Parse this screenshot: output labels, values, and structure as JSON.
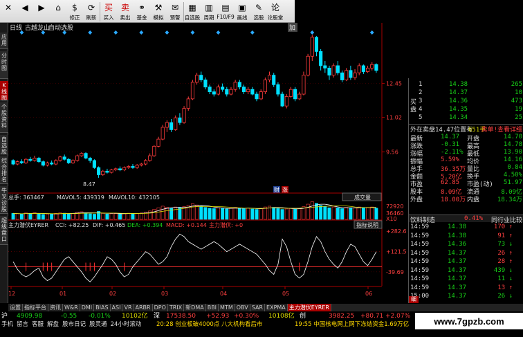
{
  "toolbar": [
    {
      "icon": "✕",
      "label": "",
      "name": "close"
    },
    {
      "icon": "◀",
      "label": "",
      "name": "back"
    },
    {
      "icon": "▶",
      "label": "",
      "name": "forward"
    },
    {
      "icon": "⌂",
      "label": "",
      "name": "home"
    },
    {
      "icon": "$",
      "label": "修正",
      "name": "correct"
    },
    {
      "icon": "⟳",
      "label": "刷新",
      "name": "refresh"
    },
    {
      "icon": "买",
      "label": "买入",
      "name": "buy"
    },
    {
      "icon": "卖",
      "label": "卖出",
      "name": "sell"
    },
    {
      "icon": "⚭",
      "label": "基金",
      "name": "fund"
    },
    {
      "icon": "⚒",
      "label": "模拟",
      "name": "simulate"
    },
    {
      "icon": "✉",
      "label": "预警",
      "name": "alert"
    },
    {
      "icon": "▦",
      "label": "自选股",
      "name": "watchlist"
    },
    {
      "icon": "▥",
      "label": "周期",
      "name": "period"
    },
    {
      "icon": "▤",
      "label": "F10/F9",
      "name": "f10"
    },
    {
      "icon": "▣",
      "label": "画线",
      "name": "draw"
    },
    {
      "icon": "✎",
      "label": "选股",
      "name": "select-stock"
    },
    {
      "icon": "论",
      "label": "论股堂",
      "name": "forum"
    }
  ],
  "left_tabs": [
    {
      "label": "应用",
      "active": false
    },
    {
      "label": "分时图",
      "active": false
    },
    {
      "label": "K线图",
      "active": true
    },
    {
      "label": "个股资料",
      "active": false
    },
    {
      "label": "自选股",
      "active": false
    },
    {
      "label": "综合排名",
      "active": false
    },
    {
      "label": "牛叉诊股",
      "active": false
    },
    {
      "label": "超级盘口",
      "active": false
    }
  ],
  "chart_header": {
    "period": "日线",
    "stock": "古越龙山",
    "mode": "自动选股",
    "add": "加"
  },
  "price_axis": [
    "12.45",
    "11.02",
    "9.56"
  ],
  "price_low_label": "8.47",
  "chart_badges": {
    "cai": "财",
    "zhang": "涨"
  },
  "volume": {
    "label": "总手: 363467",
    "ma5": "MAVOL5: 439319",
    "ma10": "MAVOL10: 432105",
    "button": "成交量",
    "axis": [
      "72920",
      "36460",
      "X10"
    ]
  },
  "indicator": {
    "title": "主力潜伏EYRER",
    "cci": "CCI: +82.25",
    "dif": "DIF: +0.465",
    "dea": "DEA: +0.394",
    "macd": "MACD: +0.144",
    "zl": "主力潜伏: +0",
    "button": "指标说明",
    "axis": [
      "+282.6",
      "+121.5",
      "-39.69"
    ]
  },
  "x_axis": [
    "12",
    "01",
    "02",
    "03",
    "04",
    "05",
    "06"
  ],
  "chart_data": {
    "type": "candlestick",
    "title": "",
    "ylim": [
      8.0,
      14.6
    ],
    "ticks": [
      12.45,
      11.02,
      9.56
    ],
    "candles": [
      [
        9.2,
        9.05,
        9.25,
        9.0
      ],
      [
        9.05,
        9.15,
        9.2,
        9.0
      ],
      [
        9.15,
        9.1,
        9.25,
        9.05
      ],
      [
        9.1,
        9.25,
        9.3,
        9.05
      ],
      [
        9.25,
        9.2,
        9.35,
        9.15
      ],
      [
        9.2,
        9.3,
        9.4,
        9.15
      ],
      [
        9.3,
        9.15,
        9.35,
        9.1
      ],
      [
        9.15,
        9.0,
        9.2,
        8.95
      ],
      [
        9.0,
        9.1,
        9.15,
        8.95
      ],
      [
        9.1,
        9.05,
        9.2,
        9.0
      ],
      [
        9.05,
        9.2,
        9.25,
        9.0
      ],
      [
        9.2,
        9.35,
        9.4,
        9.15
      ],
      [
        9.35,
        9.25,
        9.45,
        9.2
      ],
      [
        9.25,
        9.1,
        9.3,
        9.05
      ],
      [
        9.1,
        9.2,
        9.25,
        9.05
      ],
      [
        9.2,
        9.4,
        9.45,
        9.15
      ],
      [
        9.4,
        9.5,
        9.55,
        9.35
      ],
      [
        9.5,
        9.3,
        9.55,
        9.25
      ],
      [
        9.3,
        9.2,
        9.35,
        9.1
      ],
      [
        9.2,
        8.9,
        9.25,
        8.85
      ],
      [
        8.9,
        8.6,
        8.95,
        8.47
      ],
      [
        8.6,
        8.75,
        8.8,
        8.55
      ],
      [
        8.75,
        8.7,
        8.85,
        8.65
      ],
      [
        8.7,
        8.8,
        8.85,
        8.65
      ],
      [
        8.8,
        8.85,
        8.9,
        8.75
      ],
      [
        8.85,
        8.8,
        8.95,
        8.75
      ],
      [
        8.8,
        8.9,
        8.95,
        8.75
      ],
      [
        8.9,
        8.95,
        9.0,
        8.85
      ],
      [
        8.95,
        8.9,
        9.05,
        8.85
      ],
      [
        8.9,
        9.0,
        9.05,
        8.85
      ],
      [
        9.0,
        9.05,
        9.1,
        8.95
      ],
      [
        9.05,
        9.2,
        9.25,
        9.0
      ],
      [
        9.2,
        9.4,
        9.5,
        9.15
      ],
      [
        9.4,
        9.8,
        9.85,
        9.35
      ],
      [
        9.8,
        10.1,
        10.2,
        9.75
      ],
      [
        10.1,
        10.6,
        10.7,
        10.05
      ],
      [
        10.6,
        10.8,
        10.9,
        10.4
      ],
      [
        10.8,
        10.5,
        10.95,
        10.4
      ],
      [
        10.5,
        11.0,
        11.1,
        10.45
      ],
      [
        11.0,
        10.8,
        11.2,
        10.7
      ],
      [
        10.8,
        11.4,
        11.5,
        10.75
      ],
      [
        11.4,
        11.8,
        11.9,
        11.3
      ],
      [
        11.8,
        12.5,
        12.6,
        11.75
      ],
      [
        12.5,
        12.8,
        12.9,
        12.4
      ],
      [
        12.8,
        12.6,
        12.95,
        12.5
      ],
      [
        12.6,
        12.3,
        12.7,
        12.2
      ],
      [
        12.3,
        12.1,
        12.4,
        12.0
      ],
      [
        12.1,
        12.0,
        12.2,
        11.9
      ],
      [
        12.0,
        12.3,
        12.4,
        11.95
      ],
      [
        12.3,
        12.2,
        12.45,
        12.1
      ],
      [
        12.2,
        12.0,
        12.3,
        11.9
      ],
      [
        12.0,
        12.2,
        12.3,
        11.95
      ],
      [
        12.2,
        12.5,
        12.6,
        12.1
      ],
      [
        12.5,
        12.3,
        12.6,
        12.2
      ],
      [
        12.3,
        12.1,
        12.4,
        12.0
      ],
      [
        12.1,
        12.2,
        12.3,
        12.0
      ],
      [
        12.2,
        12.0,
        12.3,
        11.95
      ],
      [
        12.0,
        11.8,
        12.1,
        11.7
      ],
      [
        11.8,
        12.1,
        12.2,
        11.75
      ],
      [
        12.1,
        12.6,
        12.7,
        12.0
      ],
      [
        12.6,
        12.8,
        12.95,
        12.5
      ],
      [
        12.8,
        12.4,
        12.9,
        12.3
      ],
      [
        12.4,
        12.0,
        12.5,
        11.9
      ],
      [
        12.0,
        11.5,
        12.1,
        11.45
      ],
      [
        11.5,
        11.9,
        12.0,
        11.4
      ],
      [
        11.9,
        12.2,
        12.3,
        11.85
      ],
      [
        12.2,
        11.8,
        12.3,
        11.7
      ],
      [
        11.8,
        12.0,
        12.1,
        11.75
      ],
      [
        12.0,
        12.8,
        12.95,
        11.95
      ],
      [
        12.8,
        13.6,
        13.7,
        12.75
      ],
      [
        13.6,
        14.4,
        14.5,
        13.4
      ],
      [
        14.4,
        13.8,
        14.45,
        13.6
      ],
      [
        13.8,
        13.2,
        13.9,
        13.0
      ],
      [
        13.2,
        13.1,
        13.4,
        12.9
      ],
      [
        13.1,
        12.8,
        13.2,
        12.6
      ],
      [
        12.8,
        13.2,
        13.3,
        12.7
      ],
      [
        13.2,
        12.9,
        13.4,
        12.8
      ],
      [
        12.9,
        12.6,
        13.0,
        12.5
      ],
      [
        12.6,
        13.0,
        13.1,
        12.55
      ],
      [
        13.0,
        12.7,
        13.2,
        12.6
      ],
      [
        12.7,
        12.9,
        13.05,
        12.6
      ],
      [
        12.9,
        13.2,
        13.3,
        12.8
      ],
      [
        13.2,
        12.95,
        13.25,
        12.85
      ],
      [
        12.95,
        13.1,
        13.2,
        12.9
      ],
      [
        13.1,
        13.25,
        13.35,
        13.0
      ],
      [
        13.25,
        13.0,
        13.3,
        12.9
      ]
    ],
    "volume": [
      30,
      28,
      26,
      32,
      30,
      34,
      28,
      25,
      27,
      26,
      30,
      33,
      31,
      27,
      29,
      36,
      38,
      33,
      28,
      26,
      40,
      30,
      27,
      28,
      29,
      27,
      30,
      31,
      29,
      30,
      32,
      36,
      42,
      50,
      58,
      66,
      60,
      55,
      62,
      58,
      64,
      70,
      78,
      72,
      65,
      60,
      56,
      54,
      58,
      55,
      52,
      56,
      60,
      57,
      54,
      56,
      52,
      50,
      55,
      62,
      66,
      60,
      54,
      50,
      52,
      56,
      52,
      54,
      64,
      76,
      88,
      80,
      70,
      64,
      58,
      62,
      58,
      54,
      60,
      56,
      58,
      62,
      58,
      60,
      62,
      56
    ],
    "indicator": [
      40,
      -20,
      -60,
      -80,
      -60,
      -30,
      -10,
      -80,
      -110,
      -90,
      -40,
      10,
      60,
      80,
      40,
      0,
      -40,
      -90,
      -120,
      -80,
      -30,
      20,
      80,
      60,
      20,
      -40,
      -80,
      -60,
      0,
      40,
      80,
      120,
      100,
      60,
      20,
      40,
      80,
      160,
      220,
      260,
      240,
      200,
      180,
      160,
      140,
      160,
      180,
      200,
      180,
      150,
      120,
      140,
      160,
      180,
      160,
      140,
      120,
      100,
      60,
      20,
      -30,
      -60,
      20,
      220,
      160,
      40,
      -60,
      -90,
      -60,
      40,
      160,
      240,
      200,
      120,
      60,
      20,
      -10,
      40,
      120,
      180,
      160,
      100,
      40,
      10,
      60,
      120
    ]
  },
  "right_panel": {
    "sell": [
      {
        "lvl": "1",
        "price": "14.38",
        "vol": "265"
      },
      {
        "lvl": "2",
        "price": "14.37",
        "vol": "10"
      },
      {
        "lvl": "3",
        "price": "14.36",
        "vol": "473"
      },
      {
        "lvl": "4",
        "price": "14.35",
        "vol": "19"
      },
      {
        "lvl": "5",
        "price": "14.34",
        "vol": "25"
      }
    ],
    "buy_label": "买盘",
    "summary_line": "外在卖盘14.47位置有",
    "summary_vol": "651手",
    "summary_link": "卖单!查看详细",
    "stats": [
      {
        "l1": "最新",
        "v1": "14.37",
        "l2": "开盘",
        "v2": "14.70"
      },
      {
        "l1": "涨跌",
        "v1": "-0.31",
        "l2": "最高",
        "v2": "14.78"
      },
      {
        "l1": "涨幅",
        "v1": "-2.11%",
        "l2": "最低",
        "v2": "13.90"
      },
      {
        "l1": "振幅",
        "v1": "5.59%",
        "l2": "均价",
        "v2": "14.16"
      },
      {
        "l1": "总手",
        "v1": "36.35万",
        "l2": "量比",
        "v2": "0.84"
      },
      {
        "l1": "金额",
        "v1": "5.20亿",
        "l2": "换手",
        "v2": "4.50%"
      },
      {
        "l1": "市盈",
        "v1": "62.85",
        "l2": "市盈(动)",
        "v2": "51.97"
      },
      {
        "l1": "股本",
        "v1": "8.09亿",
        "l2": "流通",
        "v2": "8.09亿"
      },
      {
        "l1": "外盘",
        "v1": "18.00万",
        "l2": "内盘",
        "v2": "18.34万"
      }
    ],
    "industry": {
      "name": "饮料制造",
      "pct": "0.41%",
      "link": "同行业比较"
    },
    "ticks": [
      {
        "t": "14:59",
        "p": "14.38",
        "v": "170",
        "d": "up"
      },
      {
        "t": "14:59",
        "p": "14.38",
        "v": "91",
        "d": "up"
      },
      {
        "t": "14:59",
        "p": "14.36",
        "v": "73",
        "d": "down"
      },
      {
        "t": "14:59",
        "p": "14.37",
        "v": "26",
        "d": "up"
      },
      {
        "t": "14:59",
        "p": "14.37",
        "v": "28",
        "d": "up"
      },
      {
        "t": "14:59",
        "p": "14.37",
        "v": "439",
        "d": "down"
      },
      {
        "t": "14:59",
        "p": "14.37",
        "v": "11",
        "d": "down"
      },
      {
        "t": "14:59",
        "p": "14.37",
        "v": "13",
        "d": "up"
      },
      {
        "t": "15:00",
        "p": "14.37",
        "v": "26",
        "d": "down"
      }
    ],
    "tab": "细"
  },
  "bottom_tabs": [
    "设置",
    "指标平台",
    "资讯",
    "W&R",
    "DMI",
    "BIAS",
    "ASI",
    "VR",
    "ARBR",
    "DPO",
    "TRIX",
    "新DMA",
    "BBI",
    "MTM",
    "OBV",
    "SAR",
    "EXPMA",
    "主力潜伏EYRER"
  ],
  "status1": {
    "sh_label": "沪",
    "sh": "4909.98",
    "sh_chg": "-0.55",
    "sh_pct": "-0.01%",
    "sh_amt": "10102亿",
    "sz_label": "深",
    "sz": "17538.50",
    "sz_chg": "+52.93",
    "sz_pct": "+0.30%",
    "sz_amt": "10108亿",
    "cy_label": "创",
    "cy": "3982.25",
    "cy_chg": "+80.71",
    "cy_pct": "+2.07%"
  },
  "status2": {
    "menu": [
      "手机",
      "留言",
      "客服",
      "解盘",
      "股市日记",
      "股灵通",
      "24小时滚动"
    ],
    "news1": "20:28 创业板破4000点 八大机构看后市",
    "news2": "19:55 中国核电网上网下冻结资金1.69万亿"
  },
  "watermark": "www.7gpzb.com"
}
